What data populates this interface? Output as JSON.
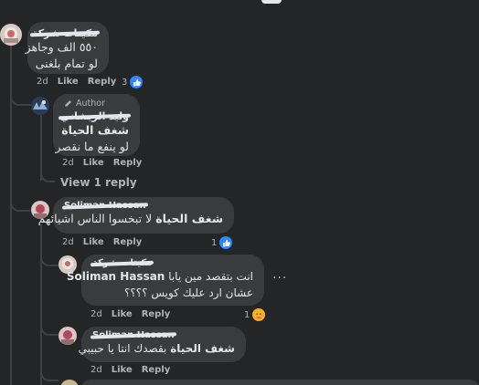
{
  "comments": [
    {
      "author": "مكيتات شركة",
      "lines": [
        "٥٥٠ الف وجاهز",
        "لو تمام بلغنى"
      ],
      "time": "2d",
      "like_label": "Like",
      "reply_label": "Reply",
      "reaction_count": "3",
      "reaction_type": "like"
    },
    {
      "author_badge": "Author",
      "author": "وليد الريشاني",
      "mention": "شغف الحياة",
      "lines": [
        "لو ينفع ما نقصر"
      ],
      "time": "2d",
      "like_label": "Like",
      "reply_label": "Reply"
    },
    {
      "view_replies": "View 1 reply"
    },
    {
      "author": "Soliman Hassan",
      "mention": "شغف الحياة",
      "text": "لا تبخسوا الناس اشيائهم",
      "time": "2d",
      "like_label": "Like",
      "reply_label": "Reply",
      "reaction_count": "1",
      "reaction_type": "like"
    },
    {
      "author": "مكيتات شركة",
      "mention": "Soliman Hassan",
      "text": "انت بتقصد مين يابا",
      "line2": "عشان ارد عليك كويس ؟؟؟؟",
      "time": "2d",
      "like_label": "Like",
      "reply_label": "Reply",
      "reaction_count": "1",
      "reaction_type": "care",
      "more_label": "···"
    },
    {
      "author": "Soliman Hassan",
      "mention": "شغف الحياة",
      "text": "بقصدك انتا يا حبيبي",
      "time": "2d",
      "like_label": "Like",
      "reply_label": "Reply"
    }
  ],
  "icons": {
    "like": "thumbs-up-icon",
    "care": "care-face-icon",
    "author_badge": "pencil-icon",
    "more": "more-horizontal-icon"
  },
  "colors": {
    "background": "#242526",
    "bubble": "#3a3b3c",
    "text": "#e4e6eb",
    "muted": "#b0b3b8",
    "like_blue": "#2d88ff",
    "care_yellow": "#f7b125"
  }
}
